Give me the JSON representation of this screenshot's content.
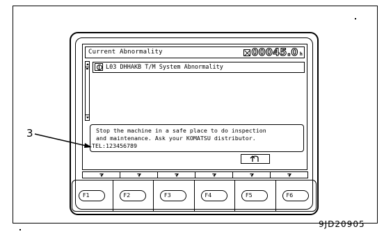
{
  "screen": {
    "title": "Current Abnormality",
    "hour_meter": {
      "icon": "hourglass-icon",
      "value": "00045.0",
      "unit": "h"
    },
    "abnormalities": [
      {
        "icon": "transmission-icon",
        "text": "L03 DHHAKB T/M System Abnormality"
      }
    ],
    "message": {
      "line1": "Stop the machine in a safe place to do inspection",
      "line2": "and maintenance. Ask your KOMATSU distributor.",
      "line3": "TEL:123456789"
    },
    "back_button_icon": "return-arrow-icon"
  },
  "function_keys": [
    "F1",
    "F2",
    "F3",
    "F4",
    "F5",
    "F6"
  ],
  "callout": {
    "label": "3"
  },
  "figure_id": "9JD20905"
}
